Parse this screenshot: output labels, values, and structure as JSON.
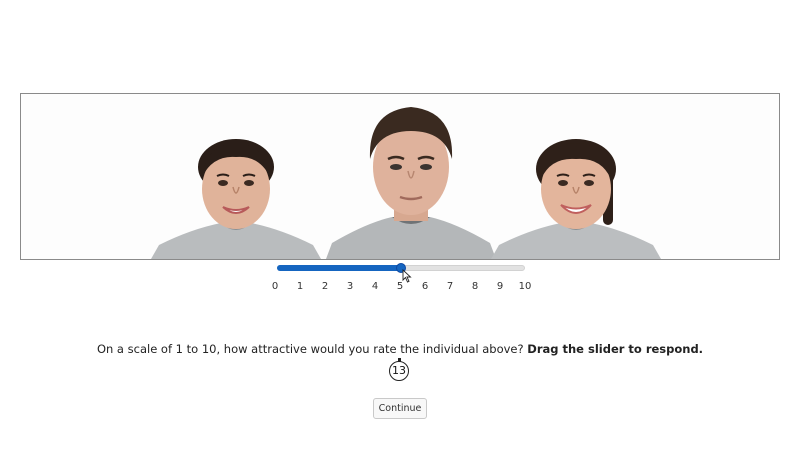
{
  "slider": {
    "min": 0,
    "max": 10,
    "value": 5,
    "fill_color": "#1565c0"
  },
  "scale_labels": [
    "0",
    "1",
    "2",
    "3",
    "4",
    "5",
    "6",
    "7",
    "8",
    "9",
    "10"
  ],
  "prompt": {
    "question": "On a scale of 1 to 10, how attractive would you rate the individual above?",
    "instruction": "Drag the slider to respond."
  },
  "timer": {
    "value": "13"
  },
  "continue_button": {
    "label": "Continue"
  },
  "stimulus": {
    "faces": [
      "face-left-woman",
      "face-center-man",
      "face-right-woman"
    ]
  }
}
